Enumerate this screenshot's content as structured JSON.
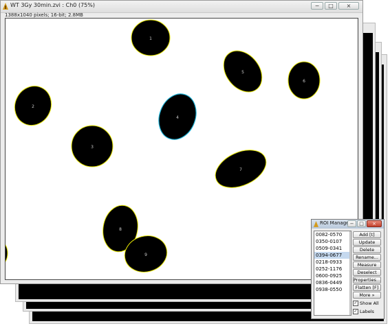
{
  "main_window": {
    "title": "WT 3Gy 30min.zvi : Ch0 (75%)",
    "info": "1388x1040 pixels; 16-bit; 2.8MB",
    "window_buttons": [
      "−",
      "□",
      "×"
    ]
  },
  "cells": [
    {
      "label": "1"
    },
    {
      "label": "2"
    },
    {
      "label": "3"
    },
    {
      "label": "4"
    },
    {
      "label": "5"
    },
    {
      "label": "6"
    },
    {
      "label": "7"
    },
    {
      "label": "8"
    },
    {
      "label": "9"
    }
  ],
  "roi_manager": {
    "title": "ROI Manager",
    "window_buttons": [
      "−",
      "□",
      "×"
    ],
    "items": [
      "0082-0570",
      "0350-0107",
      "0509-0341",
      "0394-0677",
      "0218-0933",
      "0252-1176",
      "0600-0925",
      "0836-0449",
      "0938-0550"
    ],
    "selected_item": "0394-0677",
    "buttons": {
      "add": "Add [t]",
      "update": "Update",
      "delete": "Delete",
      "rename": "Rename...",
      "measure": "Measure",
      "deselect": "Deselect",
      "properties": "Properties...",
      "flatten": "Flatten [F]",
      "more": "More »"
    },
    "show_all": {
      "label": "Show All",
      "checked": true
    },
    "labels": {
      "label": "Labels",
      "checked": true
    }
  },
  "colors": {
    "cell_fill": "#000000",
    "cell_outline": "#e8e800",
    "selected_outline": "#1fb3d8",
    "selection_highlight": "#c5d9ef"
  }
}
